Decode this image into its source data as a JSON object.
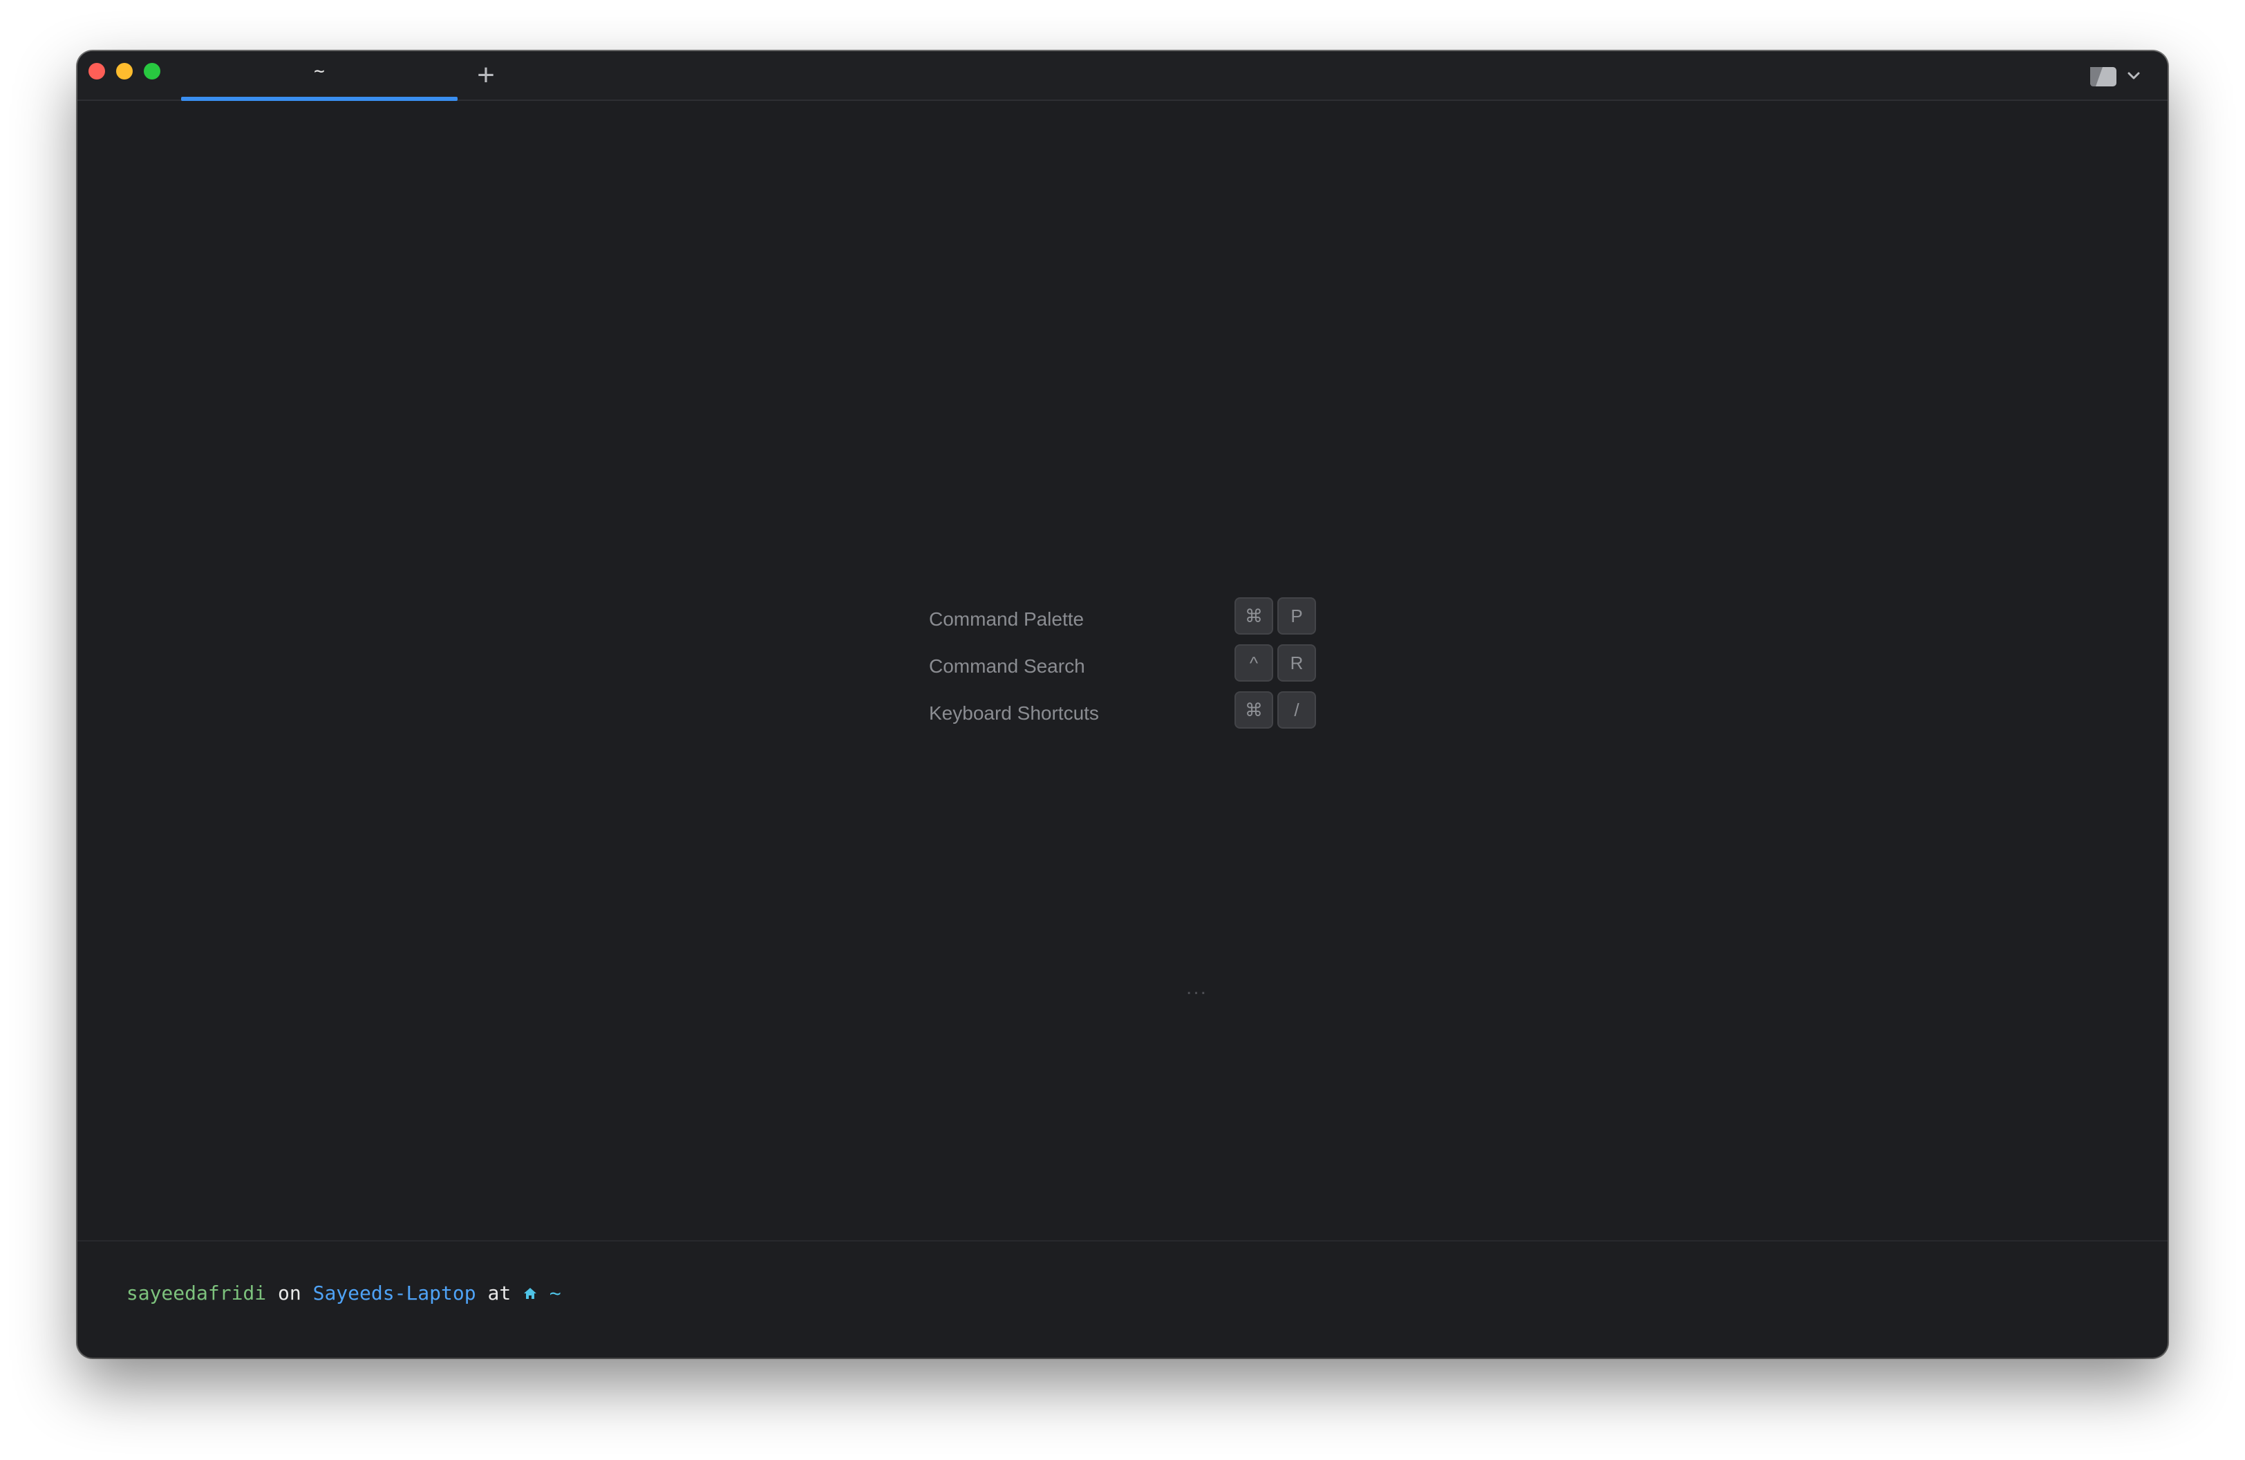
{
  "window": {
    "traffic_lights": {
      "close_color": "#fe5f57",
      "minimize_color": "#febc2e",
      "maximize_color": "#28c840"
    },
    "tabs": [
      {
        "title": "~",
        "active": true
      }
    ],
    "active_tab_color": "#3a8ef0",
    "new_tab_label": "+",
    "panel_toggle_icon": "panel-toggle-icon"
  },
  "shortcuts": [
    {
      "label": "Command Palette",
      "keys": [
        "⌘",
        "P"
      ]
    },
    {
      "label": "Command Search",
      "keys": [
        "^",
        "R"
      ]
    },
    {
      "label": "Keyboard Shortcuts",
      "keys": [
        "⌘",
        "/"
      ]
    }
  ],
  "loading_indicator": "...",
  "prompt": {
    "icon": "apple-icon",
    "icon_glyph": "",
    "user": "sayeedafridi",
    "on_word": "on",
    "host": "Sayeeds-Laptop",
    "at_word": "at",
    "home_icon": "home-icon",
    "path": "~"
  }
}
